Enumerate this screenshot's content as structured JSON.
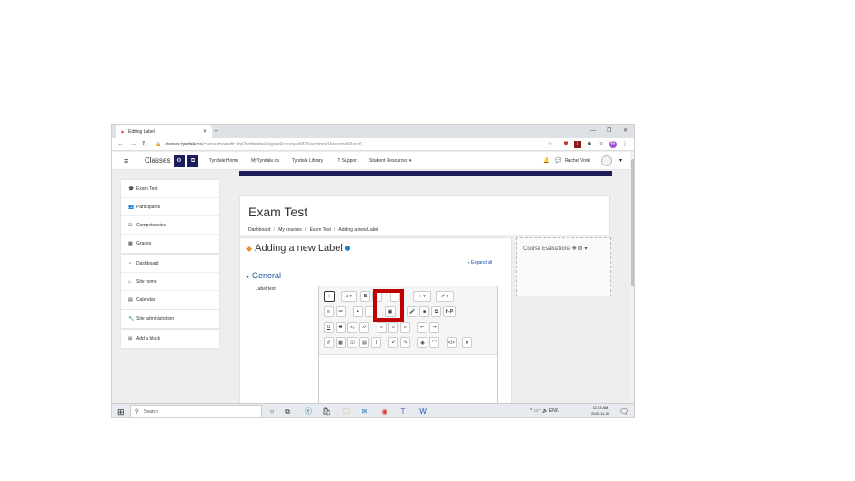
{
  "browser": {
    "tab_title": "Editing Label",
    "new_tab": "+",
    "url_host": "classes.tyndale.ca",
    "url_path": "/course/modedit.php?add=label&type=&course=681&section=0&return=0&sr=0"
  },
  "navbar": {
    "brand": "Classes",
    "links": [
      "Tyndale Home",
      "MyTyndale.ca",
      "Tyndale Library",
      "IT Support",
      "Student Resources ▾"
    ],
    "user_name": "Rachel Vonk"
  },
  "sidebar": {
    "group1": [
      "Exam Test",
      "Participants",
      "Competencies",
      "Grades"
    ],
    "group2": [
      "Dashboard",
      "Site home",
      "Calendar"
    ],
    "group3": [
      "Site administration"
    ],
    "group4": [
      "Add a block"
    ]
  },
  "page": {
    "title": "Exam Test",
    "breadcrumbs": [
      "Dashboard",
      "My courses",
      "Exam Test",
      "Adding a new Label"
    ],
    "heading": "Adding a new Label",
    "expand_all": "Expand all",
    "section": "General",
    "field_label": "Label text"
  },
  "editor": {
    "row1": [
      "i",
      "A ▾",
      "B",
      "I",
      "",
      "♀ ▾",
      "✐ ▾"
    ],
    "row2": [
      "≡",
      "≔",
      "⚭",
      "",
      "▣",
      "🎤",
      "■",
      "⧉",
      "H-P"
    ],
    "row3": [
      "U",
      "S",
      "x₂",
      "x²",
      "≡",
      "≡",
      "≡",
      "⇤",
      "⇥"
    ],
    "row4": [
      "#",
      "▦",
      "☑",
      "▤",
      "I",
      "↶",
      "↷",
      "◉",
      "⌜⌝",
      "</>",
      "✕"
    ]
  },
  "block": {
    "title": "Course Evaluations"
  },
  "taskbar": {
    "search_placeholder": "Search",
    "tray_lang": "ENG",
    "time": "11:03 AM",
    "date": "2020-11-30"
  }
}
